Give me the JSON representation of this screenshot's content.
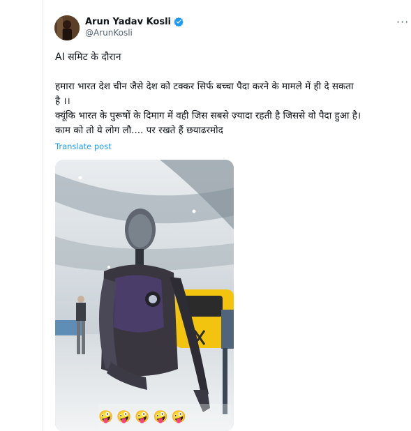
{
  "post": {
    "author": {
      "display_name": "Arun Yadav Kosli",
      "handle": "@ArunKosli",
      "verified": true,
      "avatar_icon": "profile-avatar"
    },
    "more_label": "···",
    "title_line": "AI समिट के दौरान",
    "body_lines": [
      "हमारा भारत देश चीन जैसे देश को टक्कर सिर्फ बच्चा पैदा करने के मामले में ही दे सकता",
      "है ।।",
      "क्यूंकि भारत के पुरूषों के दिमाग में वही जिस सबसे ज़्यादा रहती है जिससे वो पैदा हुआ है।",
      "काम को तो ये लोग लौ.... पर रखते हैं छयाढरमोद"
    ],
    "translate_label": "Translate post",
    "media": {
      "description_icon": "video-thumbnail",
      "emoji_overlay": [
        "🤪",
        "🤪",
        "🤪",
        "🤪",
        "🤪"
      ]
    }
  },
  "colors": {
    "link_blue": "#1d9bf0",
    "verified_blue": "#1d9bf0",
    "secondary_text": "#536471"
  }
}
